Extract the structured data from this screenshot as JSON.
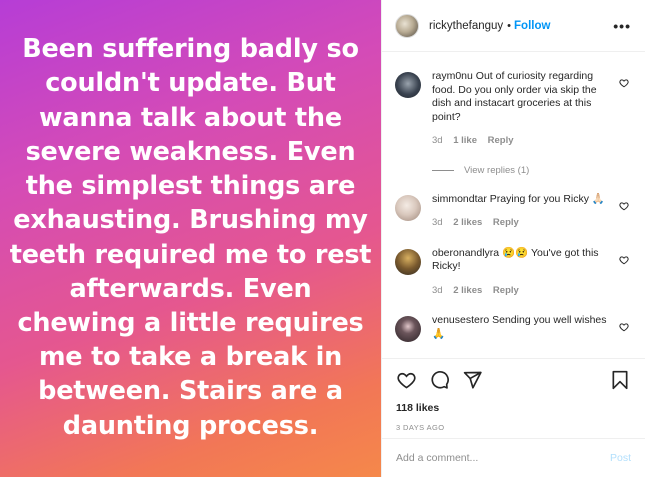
{
  "media": {
    "lines": [
      "Been suffering badly so",
      "couldn't update. But",
      "wanna talk about the",
      "severe weakness. Even",
      "the simplest things are",
      "exhausting. Brushing my",
      "teeth required me to rest",
      "afterwards. Even",
      "chewing a little requires",
      "me to take a break in",
      "between. Stairs are a",
      "daunting process."
    ]
  },
  "header": {
    "username": "rickythefanguy",
    "separator": "•",
    "follow_label": "Follow",
    "more_icon": "more-horizontal-icon",
    "more_label": "•••"
  },
  "comments": [
    {
      "username": "raym0nu",
      "text": "Out of curiosity regarding food. Do you only order via skip the dish and instacart groceries at this point?",
      "time": "3d",
      "likes": "1 like",
      "reply": "Reply",
      "view_replies": "View replies (1)",
      "avatar_color": "#3a4350"
    },
    {
      "username": "simmondtar",
      "text": "Praying for you Ricky 🙏🏻",
      "time": "3d",
      "likes": "2 likes",
      "reply": "Reply",
      "avatar_color": "#d9c8bd"
    },
    {
      "username": "oberonandlyra",
      "text": "😢😢 You've got this Ricky!",
      "time": "3d",
      "likes": "2 likes",
      "reply": "Reply",
      "avatar_color": "#7a5a2e"
    },
    {
      "username": "venusestero",
      "text": "Sending you well wishes 🙏",
      "avatar_color": "#2b2226"
    }
  ],
  "actions": {
    "likes": "118 likes",
    "date": "3 DAYS AGO"
  },
  "add_comment": {
    "placeholder": "Add a comment...",
    "post_label": "Post"
  },
  "colors": {
    "follow": "#0095f6",
    "post_disabled": "#b2dffc",
    "muted": "#8e8e8e"
  }
}
